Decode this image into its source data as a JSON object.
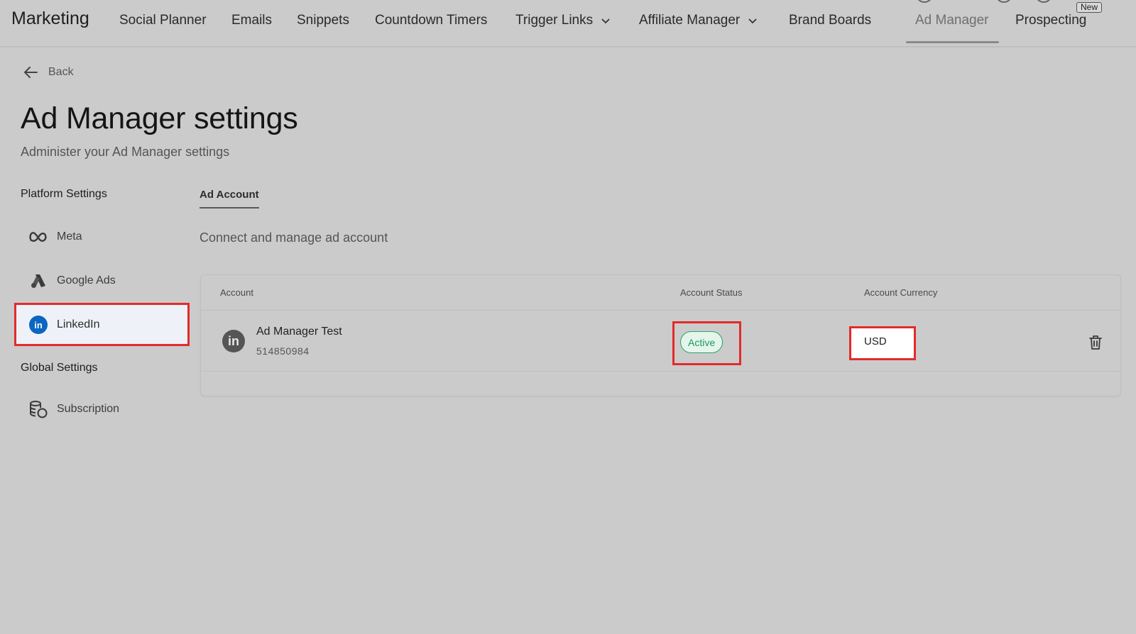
{
  "nav": {
    "brand": "Marketing",
    "items": [
      {
        "label": "Social Planner"
      },
      {
        "label": "Emails"
      },
      {
        "label": "Snippets"
      },
      {
        "label": "Countdown Timers"
      },
      {
        "label": "Trigger Links",
        "dropdown": true
      },
      {
        "label": "Affiliate Manager",
        "dropdown": true
      },
      {
        "label": "Brand Boards"
      },
      {
        "label": "Ad Manager",
        "active": true
      },
      {
        "label": "Prospecting"
      }
    ],
    "new_badge": "New"
  },
  "back_label": "Back",
  "page": {
    "title": "Ad Manager settings",
    "subtitle": "Administer your Ad Manager settings"
  },
  "sidebar": {
    "platform_heading": "Platform Settings",
    "platform_items": [
      {
        "label": "Meta",
        "icon": "meta-icon"
      },
      {
        "label": "Google Ads",
        "icon": "google-ads-icon"
      },
      {
        "label": "LinkedIn",
        "icon": "linkedin-icon",
        "selected": true
      }
    ],
    "global_heading": "Global Settings",
    "global_items": [
      {
        "label": "Subscription",
        "icon": "subscription-icon"
      }
    ]
  },
  "main": {
    "tab_label": "Ad Account",
    "description": "Connect and manage ad account",
    "table": {
      "headers": [
        "Account",
        "Account Status",
        "Account Currency"
      ],
      "rows": [
        {
          "name": "Ad Manager Test",
          "id": "514850984",
          "status": "Active",
          "currency": "USD"
        }
      ]
    }
  },
  "colors": {
    "highlight": "#e22b2b",
    "status_active": "#1d9a5e",
    "linkedin": "#0a66c2"
  }
}
